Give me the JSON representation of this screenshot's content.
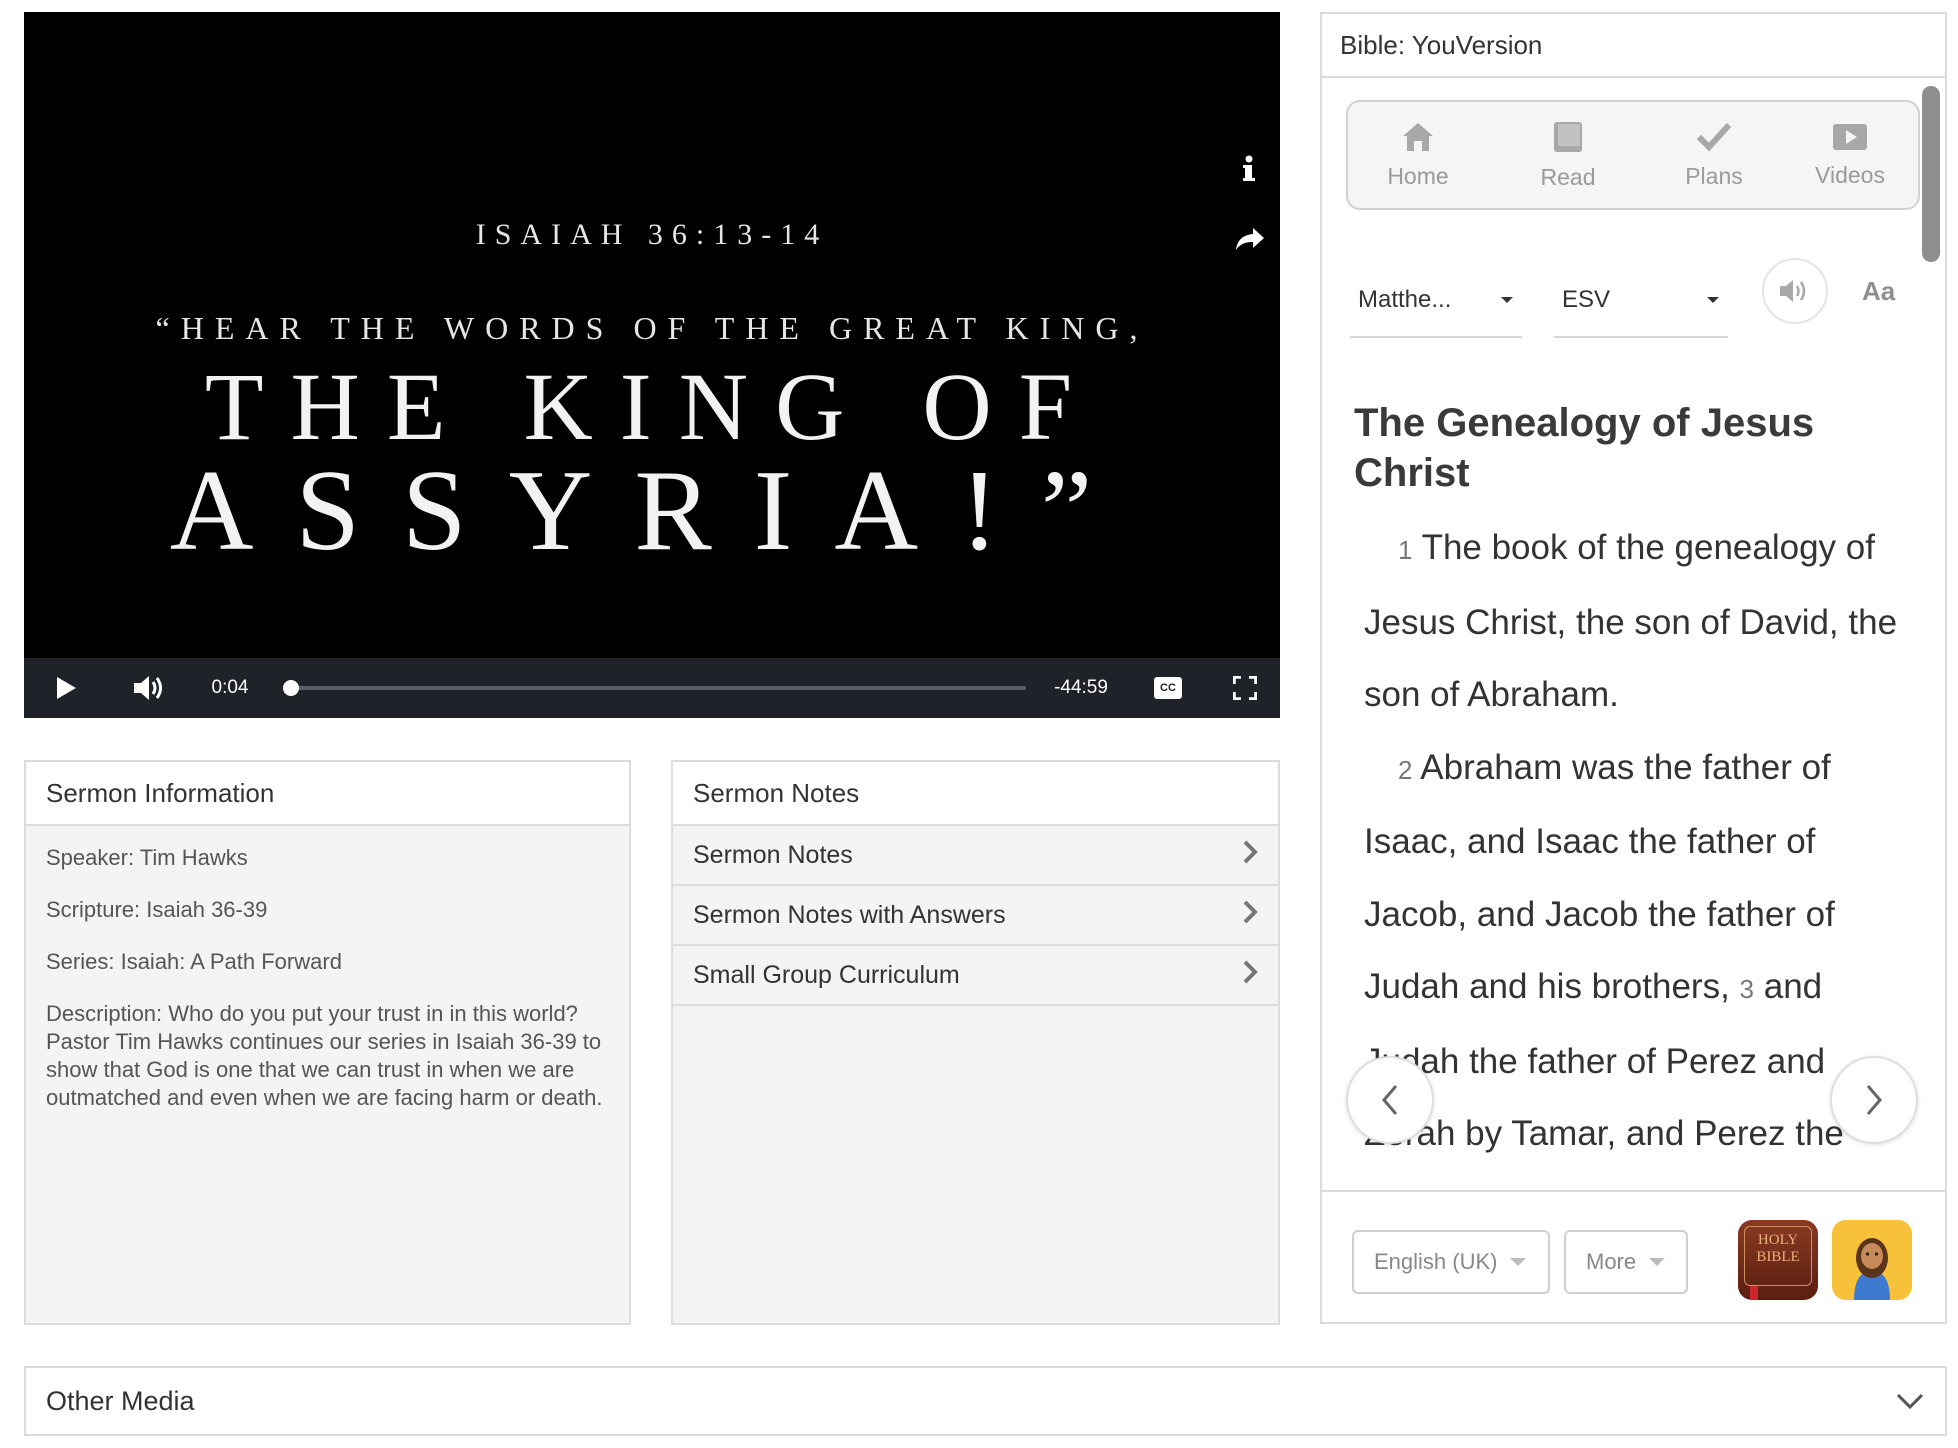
{
  "video": {
    "slide": {
      "reference": "ISAIAH 36:13-14",
      "quote_line": "“HEAR THE WORDS OF THE GREAT KING,",
      "line1": "THE KING OF",
      "line2": "ASSYRIA!”"
    },
    "side_icons": [
      "info-icon",
      "share-icon"
    ],
    "controls": {
      "play_icon": "play-icon",
      "volume_icon": "volume-icon",
      "elapsed": "0:04",
      "remaining": "-44:59",
      "progress_fraction": 0.009,
      "cc_label": "CC",
      "fullscreen_icon": "fullscreen-icon"
    }
  },
  "sermon_info": {
    "title": "Sermon Information",
    "speaker": "Speaker: Tim Hawks",
    "scripture": "Scripture: Isaiah 36-39",
    "series": "Series: Isaiah: A Path Forward",
    "description": "Description: Who do you put your trust in in this world? Pastor Tim Hawks continues our series in Isaiah 36-39 to show that God is one that we can trust in when we are outmatched and even when we are facing harm or death."
  },
  "sermon_notes": {
    "title": "Sermon Notes",
    "items": [
      {
        "label": "Sermon Notes"
      },
      {
        "label": "Sermon Notes with Answers"
      },
      {
        "label": "Small Group Curriculum"
      }
    ]
  },
  "bible": {
    "title": "Bible: YouVersion",
    "nav": [
      {
        "label": "Home",
        "icon": "home-icon"
      },
      {
        "label": "Read",
        "icon": "book-icon"
      },
      {
        "label": "Plans",
        "icon": "checkmark-icon"
      },
      {
        "label": "Videos",
        "icon": "video-icon"
      }
    ],
    "book_select": "Matthe...",
    "version_select": "ESV",
    "font_button": "Aa",
    "heading": "The Genealogy of Jesus Christ",
    "verses": {
      "v1_num": "1",
      "v1_text": "The book of the genealogy of Jesus Christ, the son of David, the son of Abraham.",
      "v2_num": "2",
      "v2_text": "Abraham was the father of Isaac, and Isaac the father of Jacob, and Jacob the father of Judah and his brothers,",
      "v3_num": "3",
      "v3_text": "and Judah the father of Perez and Zerah by Tamar, and Perez the father of Hezron, and Hezron the father of Ram,"
    },
    "footer": {
      "language": "English (UK)",
      "more": "More",
      "app_icons": [
        "holy-bible-app-icon",
        "bible-for-kids-app-icon"
      ],
      "bible_icon_text_1": "HOLY",
      "bible_icon_text_2": "BIBLE"
    }
  },
  "other_media": {
    "title": "Other Media"
  }
}
